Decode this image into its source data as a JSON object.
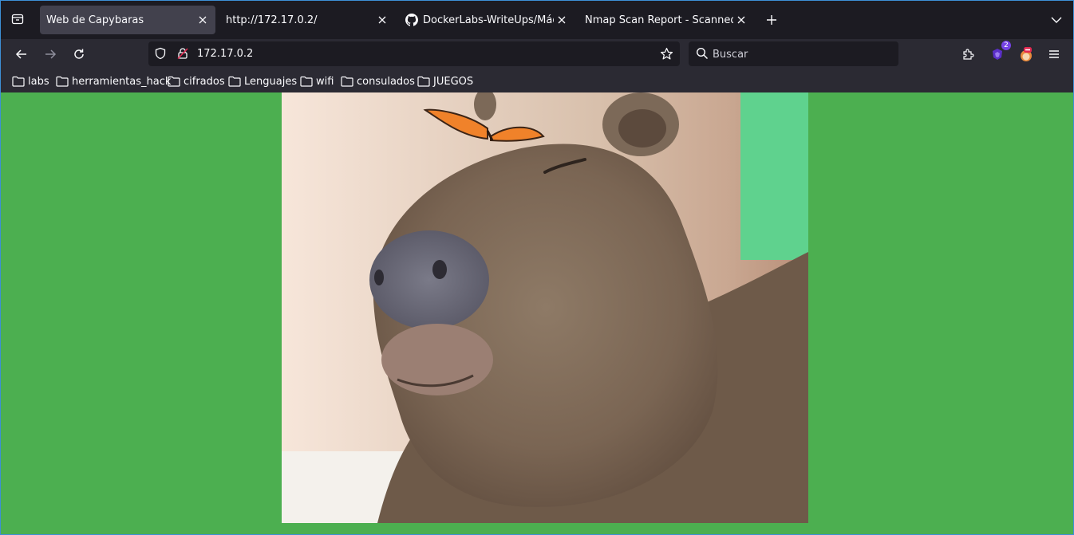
{
  "colors": {
    "page_background": "#4caf50",
    "toolbar": "#2b2a33",
    "tabstrip": "#1c1b22",
    "accent": "#3d8fd6"
  },
  "tabs": [
    {
      "label": "Web de Capybaras",
      "active": true
    },
    {
      "label": "http://172.17.0.2/",
      "active": false
    },
    {
      "label": "DockerLabs-WriteUps/Máquinas",
      "active": false,
      "icon": "github-icon"
    },
    {
      "label": "Nmap Scan Report - Scanned at M",
      "active": false
    }
  ],
  "navbar": {
    "url": "172.17.0.2",
    "search_placeholder": "Buscar",
    "extension_badge": "2"
  },
  "bookmarks": [
    {
      "label": "labs"
    },
    {
      "label": "herramientas_hack"
    },
    {
      "label": "cifrados"
    },
    {
      "label": "Lenguajes"
    },
    {
      "label": "wifi"
    },
    {
      "label": "consulados"
    },
    {
      "label": "JUEGOS"
    }
  ],
  "page": {
    "image_subject": "capybara-with-butterfly"
  }
}
